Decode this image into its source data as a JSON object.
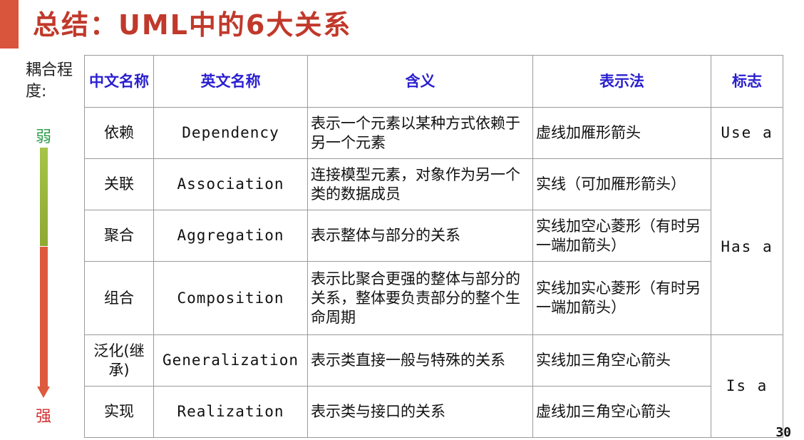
{
  "title": "总结：UML中的6大关系",
  "coupling": {
    "label": "耦合程度:",
    "weak": "弱",
    "strong": "强"
  },
  "colors": {
    "accent": "#d9553b",
    "title": "#c0392b",
    "header_text": "#2a1fd0",
    "weak": "#2e9e4e",
    "strong": "#d32f2f",
    "arrow_top": "#a6c447",
    "arrow_bottom": "#dd5a3e"
  },
  "table": {
    "headers": [
      "中文名称",
      "英文名称",
      "含义",
      "表示法",
      "标志"
    ],
    "rows": [
      {
        "cn": "依赖",
        "en": "Dependency",
        "meaning": "表示一个元素以某种方式依赖于另一个元素",
        "notation": "虚线加雁形箭头"
      },
      {
        "cn": "关联",
        "en": "Association",
        "meaning": "连接模型元素，对象作为另一个类的数据成员",
        "notation": "实线（可加雁形箭头）"
      },
      {
        "cn": "聚合",
        "en": "Aggregation",
        "meaning": "表示整体与部分的关系",
        "notation": "实线加空心菱形（有时另一端加箭头）"
      },
      {
        "cn": "组合",
        "en": "Composition",
        "meaning": "表示比聚合更强的整体与部分的关系，整体要负责部分的整个生命周期",
        "notation": "实线加实心菱形（有时另一端加箭头）"
      },
      {
        "cn": "泛化(继承)",
        "en": "Generalization",
        "meaning": "表示类直接一般与特殊的关系",
        "notation": "实线加三角空心箭头"
      },
      {
        "cn": "实现",
        "en": "Realization",
        "meaning": "表示类与接口的关系",
        "notation": "虚线加三角空心箭头"
      }
    ],
    "marks": {
      "use": "Use a",
      "has": "Has a",
      "is": "Is a"
    }
  },
  "page_number": "30"
}
